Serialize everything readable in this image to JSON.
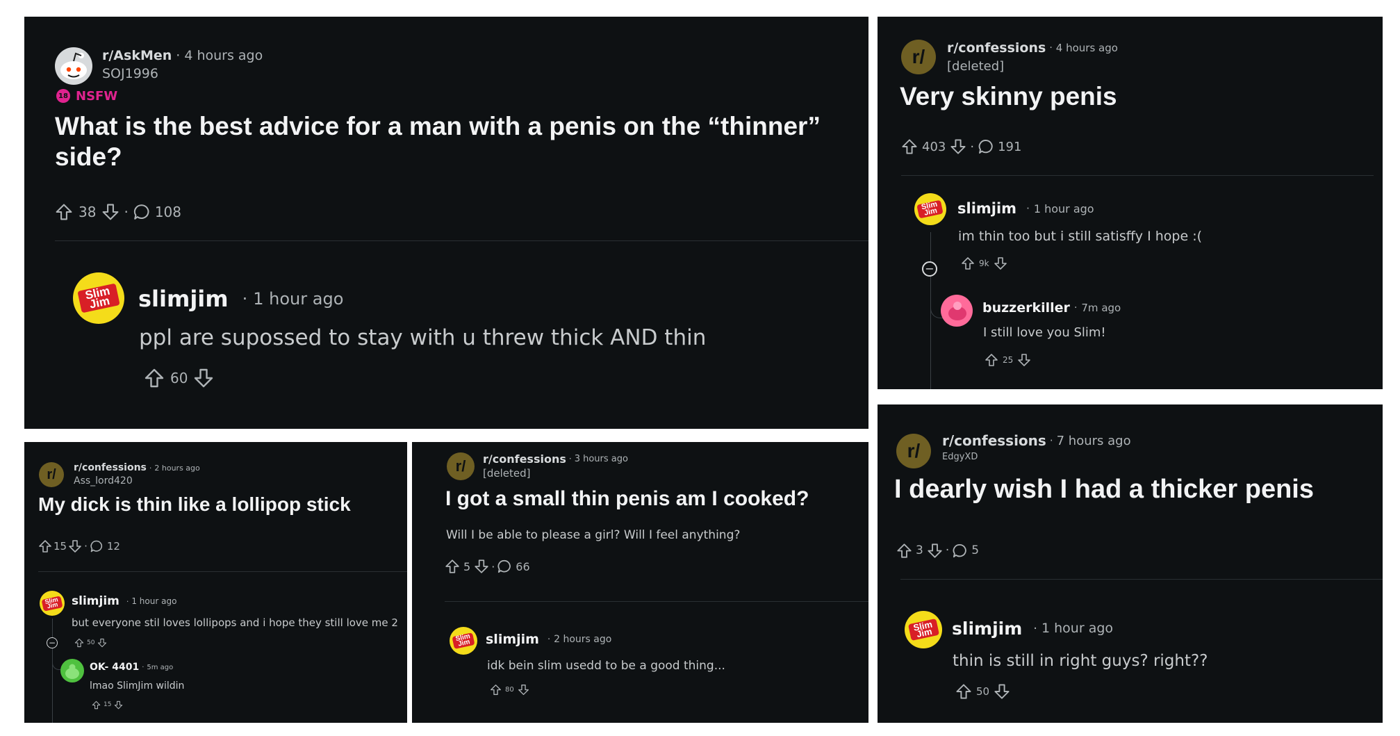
{
  "panel1": {
    "subreddit": "r/AskMen",
    "time": "4 hours ago",
    "author": "SOJ1996",
    "nsfw_label": "NSFW",
    "title": "What is the best advice for a man with a penis on the “thinner” side?",
    "upvotes": "38",
    "comments": "108",
    "comment": {
      "user": "slimjim",
      "time": "1 hour ago",
      "text": "ppl are supossed to stay with u threw thick AND thin",
      "votes": "60"
    }
  },
  "panel2": {
    "subreddit": "r/confessions",
    "time": "4 hours ago",
    "author": "[deleted]",
    "title": "Very skinny penis",
    "upvotes": "403",
    "comments": "191",
    "comment": {
      "user": "slimjim",
      "time": "1 hour ago",
      "text": "im thin too but i still satisffy I hope :(",
      "votes": "9k"
    },
    "reply": {
      "user": "buzzerkiller",
      "time": "7m ago",
      "text": "I still love you Slim!",
      "votes": "25"
    }
  },
  "panel3": {
    "subreddit": "r/confessions",
    "time": "2 hours ago",
    "author": "Ass_lord420",
    "title": "My dick is thin like a lollipop stick",
    "upvotes": "15",
    "comments": "12",
    "comment": {
      "user": "slimjim",
      "time": "1 hour ago",
      "text": "but everyone stil loves lollipops and i hope they still love me 2",
      "votes": "50"
    },
    "reply": {
      "user": "OK- 4401",
      "time": "5m ago",
      "text": "lmao SlimJim wildin",
      "votes": "15"
    }
  },
  "panel4": {
    "subreddit": "r/confessions",
    "time": "3 hours ago",
    "author": "[deleted]",
    "title": "I got a small thin penis am I cooked?",
    "body": "Will I be able to please a girl? Will I feel anything?",
    "upvotes": "5",
    "comments": "66",
    "comment": {
      "user": "slimjim",
      "time": "2 hours ago",
      "text": "idk bein slim usedd to be a good thing...",
      "votes": "80"
    }
  },
  "panel5": {
    "subreddit": "r/confessions",
    "time": "7 hours ago",
    "author": "EdgyXD",
    "title": "I dearly wish I had a thicker penis",
    "upvotes": "3",
    "comments": "5",
    "comment": {
      "user": "slimjim",
      "time": "1 hour ago",
      "text": "thin is still in right guys? right??",
      "votes": "50"
    }
  },
  "common": {
    "dot": "·",
    "sub_avatar_text": "r/",
    "slim_avatar_text": "Slim Jim",
    "nsfw_badge": "18",
    "collapse_glyph": "−"
  },
  "colors": {
    "panel_bg": "#0e1113",
    "nsfw": "#e0238f",
    "sub_avatar": "#6f5f23",
    "slimjim_yellow": "#f4dc1a",
    "slimjim_red": "#d81f26"
  }
}
